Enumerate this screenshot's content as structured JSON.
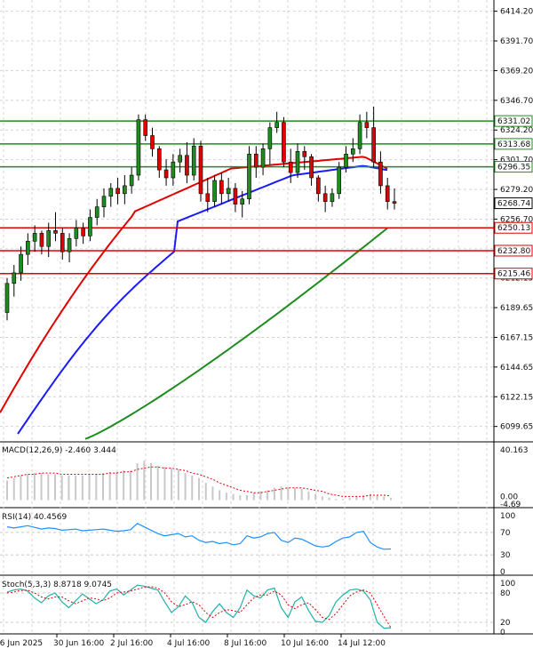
{
  "chart_data": [
    {
      "type": "candlestick",
      "price_axis": {
        "min": 6090,
        "max": 6420,
        "ticks": [
          "6414.20",
          "6391.70",
          "6369.20",
          "6346.70",
          "6324.20",
          "6301.70",
          "6279.20",
          "6256.70",
          "6234.20",
          "6212.15",
          "6189.65",
          "6167.15",
          "6144.65",
          "6122.15",
          "6099.65"
        ]
      },
      "x_labels": [
        "26 Jun 2025",
        "30 Jun 16:00",
        "2 Jul 16:00",
        "4 Jul 16:00",
        "8 Jul 16:00",
        "10 Jul 16:00",
        "14 Jul 12:00"
      ],
      "current_price": "6268.74",
      "levels": [
        {
          "label": "6331.02",
          "value": 6331.02,
          "color": "#1e8c1e"
        },
        {
          "label": "6313.68",
          "value": 6313.68,
          "color": "#1e8c1e"
        },
        {
          "label": "6296.35",
          "value": 6296.35,
          "color": "#1e8c1e"
        },
        {
          "label": "6250.13",
          "value": 6250.13,
          "color": "#e00000"
        },
        {
          "label": "6232.80",
          "value": 6232.8,
          "color": "#e00000"
        },
        {
          "label": "6215.46",
          "value": 6215.46,
          "color": "#e00000"
        }
      ],
      "candles": [
        [
          6186,
          6212,
          6180,
          6208
        ],
        [
          6208,
          6222,
          6198,
          6216
        ],
        [
          6216,
          6236,
          6210,
          6230
        ],
        [
          6230,
          6246,
          6222,
          6240
        ],
        [
          6240,
          6252,
          6232,
          6246
        ],
        [
          6246,
          6248,
          6230,
          6236
        ],
        [
          6236,
          6254,
          6228,
          6248
        ],
        [
          6248,
          6262,
          6240,
          6246
        ],
        [
          6246,
          6250,
          6226,
          6232
        ],
        [
          6232,
          6246,
          6224,
          6242
        ],
        [
          6242,
          6256,
          6236,
          6250
        ],
        [
          6250,
          6254,
          6238,
          6244
        ],
        [
          6244,
          6264,
          6240,
          6258
        ],
        [
          6258,
          6272,
          6252,
          6266
        ],
        [
          6266,
          6280,
          6258,
          6274
        ],
        [
          6274,
          6284,
          6266,
          6280
        ],
        [
          6280,
          6288,
          6268,
          6276
        ],
        [
          6276,
          6290,
          6268,
          6282
        ],
        [
          6282,
          6296,
          6276,
          6290
        ],
        [
          6290,
          6336,
          6286,
          6332
        ],
        [
          6332,
          6336,
          6316,
          6320
        ],
        [
          6320,
          6326,
          6304,
          6310
        ],
        [
          6310,
          6312,
          6288,
          6294
        ],
        [
          6294,
          6302,
          6282,
          6288
        ],
        [
          6288,
          6306,
          6282,
          6300
        ],
        [
          6300,
          6310,
          6292,
          6305
        ],
        [
          6305,
          6315,
          6284,
          6290
        ],
        [
          6290,
          6318,
          6286,
          6312
        ],
        [
          6312,
          6316,
          6270,
          6276
        ],
        [
          6276,
          6288,
          6262,
          6270
        ],
        [
          6270,
          6290,
          6266,
          6286
        ],
        [
          6286,
          6292,
          6268,
          6276
        ],
        [
          6276,
          6288,
          6270,
          6280
        ],
        [
          6280,
          6284,
          6262,
          6268
        ],
        [
          6268,
          6278,
          6258,
          6272
        ],
        [
          6272,
          6312,
          6268,
          6306
        ],
        [
          6306,
          6312,
          6288,
          6296
        ],
        [
          6296,
          6314,
          6290,
          6310
        ],
        [
          6310,
          6330,
          6298,
          6326
        ],
        [
          6326,
          6338,
          6322,
          6330
        ],
        [
          6330,
          6334,
          6296,
          6300
        ],
        [
          6300,
          6310,
          6284,
          6292
        ],
        [
          6292,
          6314,
          6288,
          6308
        ],
        [
          6308,
          6312,
          6294,
          6304
        ],
        [
          6304,
          6306,
          6282,
          6288
        ],
        [
          6288,
          6290,
          6270,
          6276
        ],
        [
          6276,
          6282,
          6262,
          6270
        ],
        [
          6270,
          6280,
          6266,
          6276
        ],
        [
          6276,
          6300,
          6272,
          6296
        ],
        [
          6296,
          6312,
          6292,
          6306
        ],
        [
          6306,
          6318,
          6300,
          6310
        ],
        [
          6310,
          6336,
          6306,
          6330
        ],
        [
          6330,
          6338,
          6318,
          6326
        ],
        [
          6326,
          6342,
          6296,
          6300
        ],
        [
          6300,
          6308,
          6276,
          6282
        ],
        [
          6282,
          6288,
          6264,
          6270
        ],
        [
          6270,
          6280,
          6264,
          6268.74
        ]
      ],
      "indicators": {
        "macd": {
          "label": "MACD(12,26,9) -2.460 3.444",
          "axis_top": "40.163",
          "axis_zero": "0.00",
          "axis_bottom": "-4.69",
          "min": -4.69,
          "max": 40.163,
          "hist": [
            16,
            18,
            20,
            21,
            22,
            22,
            21,
            21,
            20,
            20,
            20,
            20,
            21,
            21,
            22,
            23,
            23,
            24,
            24,
            30,
            32,
            30,
            28,
            27,
            26,
            25,
            22,
            20,
            18,
            14,
            11,
            8,
            6,
            5,
            4,
            4,
            6,
            7,
            8,
            10,
            11,
            10,
            10,
            9,
            7,
            5,
            3,
            2,
            1,
            1,
            2,
            3,
            4,
            5,
            4,
            3,
            2
          ],
          "signal": [
            18,
            19,
            20,
            21,
            21,
            22,
            22,
            22,
            21,
            21,
            21,
            21,
            21,
            21,
            21,
            22,
            22,
            23,
            23,
            25,
            26,
            27,
            27,
            26,
            26,
            25,
            24,
            22,
            21,
            19,
            17,
            14,
            12,
            10,
            8,
            7,
            6,
            6,
            7,
            8,
            9,
            10,
            10,
            10,
            9,
            8,
            7,
            5,
            4,
            3,
            3,
            3,
            3,
            4,
            4,
            4,
            3.4
          ]
        },
        "rsi": {
          "label": "RSI(14) 40.4569",
          "ticks": [
            "100",
            "70",
            "30",
            "0"
          ],
          "values": [
            80,
            78,
            80,
            82,
            79,
            76,
            78,
            77,
            74,
            75,
            76,
            73,
            74,
            75,
            76,
            74,
            72,
            73,
            75,
            86,
            80,
            74,
            68,
            64,
            66,
            68,
            62,
            64,
            56,
            52,
            54,
            50,
            52,
            48,
            50,
            64,
            60,
            62,
            68,
            70,
            56,
            52,
            60,
            58,
            52,
            46,
            44,
            46,
            54,
            60,
            62,
            70,
            72,
            52,
            44,
            40,
            40.4569
          ]
        },
        "stoch": {
          "label": "Stoch(5,3,3) 8.8718 9.0745",
          "ticks": [
            "100",
            "80",
            "20",
            "0"
          ],
          "k": [
            82,
            86,
            88,
            84,
            70,
            60,
            74,
            80,
            62,
            50,
            64,
            78,
            68,
            58,
            66,
            84,
            88,
            76,
            86,
            96,
            94,
            90,
            86,
            62,
            40,
            52,
            74,
            60,
            30,
            20,
            42,
            58,
            40,
            30,
            50,
            86,
            74,
            70,
            86,
            90,
            50,
            30,
            62,
            72,
            44,
            22,
            20,
            34,
            62,
            76,
            86,
            88,
            84,
            66,
            20,
            8,
            8.8718
          ],
          "d": [
            80,
            82,
            85,
            86,
            80,
            72,
            68,
            72,
            72,
            64,
            58,
            64,
            70,
            68,
            64,
            70,
            80,
            82,
            84,
            88,
            92,
            93,
            90,
            80,
            62,
            52,
            56,
            62,
            56,
            40,
            30,
            40,
            46,
            44,
            40,
            56,
            70,
            76,
            76,
            84,
            76,
            56,
            48,
            56,
            60,
            46,
            30,
            26,
            38,
            56,
            74,
            82,
            86,
            80,
            56,
            32,
            9.0745
          ]
        }
      }
    }
  ]
}
